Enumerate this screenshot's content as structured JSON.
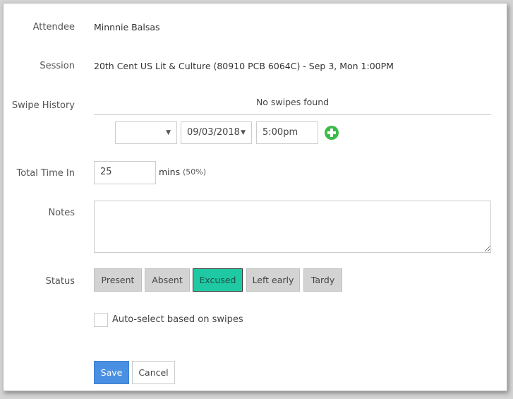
{
  "attendee": {
    "label": "Attendee",
    "value": "Minnnie Balsas"
  },
  "session": {
    "label": "Session",
    "value": "20th Cent US Lit & Culture (80910 PCB 6064C) - Sep 3, Mon 1:00PM"
  },
  "swipe_history": {
    "label": "Swipe History",
    "empty_text": "No swipes found",
    "type_select_value": "",
    "date_value": "09/03/2018",
    "time_value": "5:00pm"
  },
  "total_time": {
    "label": "Total Time In",
    "value": "25",
    "unit": "mins",
    "percent": "(50%)"
  },
  "notes": {
    "label": "Notes",
    "value": ""
  },
  "status": {
    "label": "Status",
    "options": [
      "Present",
      "Absent",
      "Excused",
      "Left early",
      "Tardy"
    ],
    "selected": "Excused"
  },
  "auto_select": {
    "label": "Auto-select based on swipes",
    "checked": false
  },
  "actions": {
    "save_label": "Save",
    "cancel_label": "Cancel"
  },
  "colors": {
    "status_active": "#1ec9a3",
    "save_button": "#4a90e2",
    "add_icon": "#3dbb4a"
  }
}
